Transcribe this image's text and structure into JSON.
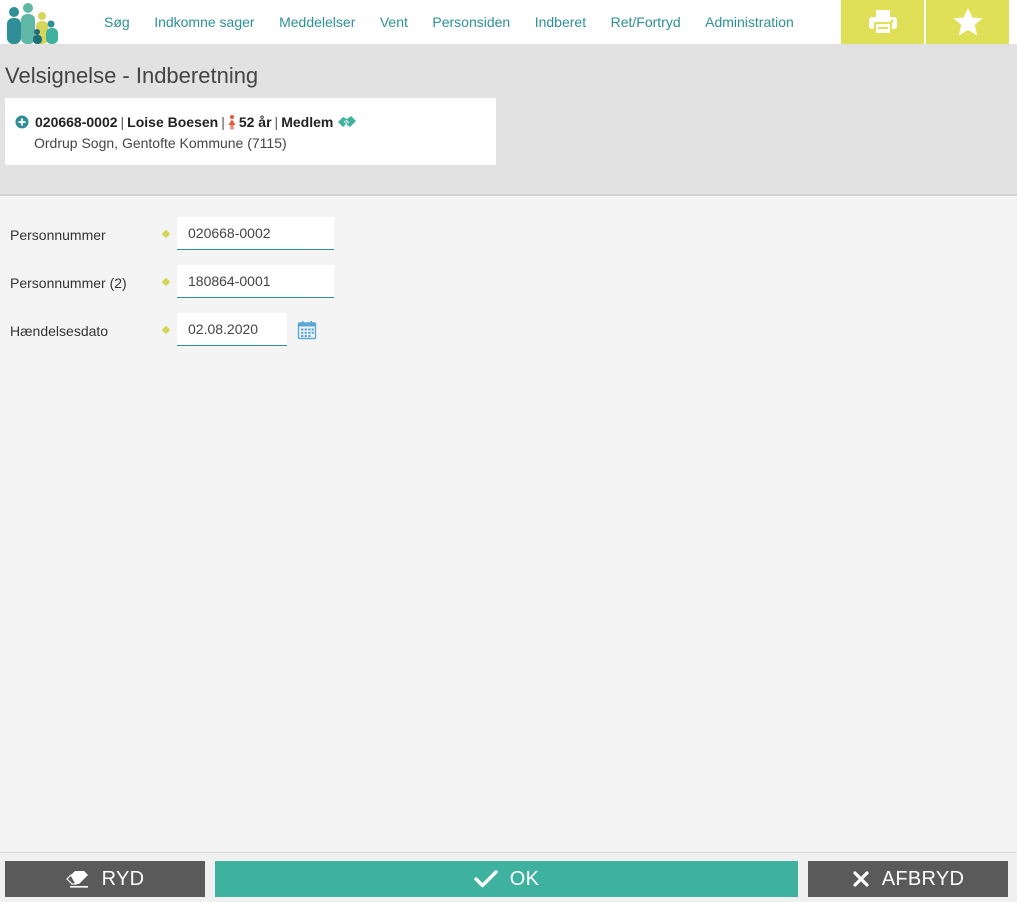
{
  "nav": {
    "items": [
      {
        "label": "Søg"
      },
      {
        "label": "Indkomne sager"
      },
      {
        "label": "Meddelelser"
      },
      {
        "label": "Vent"
      },
      {
        "label": "Personsiden"
      },
      {
        "label": "Indberet"
      },
      {
        "label": "Ret/Fortryd"
      },
      {
        "label": "Administration"
      }
    ],
    "tools": {
      "print_icon": "print-icon",
      "favorite_icon": "star-icon"
    }
  },
  "header": {
    "title": "Velsignelse - Indberetning",
    "person": {
      "cpr": "020668-0002",
      "name": "Loise Boesen",
      "age": "52 år",
      "status": "Medlem",
      "location": "Ordrup Sogn, Gentofte Kommune (7115)"
    }
  },
  "form": {
    "fields": [
      {
        "label": "Personnummer",
        "value": "020668-0002"
      },
      {
        "label": "Personnummer (2)",
        "value": "180864-0001"
      },
      {
        "label": "Hændelsesdato",
        "value": "02.08.2020"
      }
    ]
  },
  "footer": {
    "clear_label": "RYD",
    "ok_label": "OK",
    "cancel_label": "AFBRYD"
  },
  "colors": {
    "accent": "#2e8f98",
    "ok": "#3fb29f",
    "tool": "#e0e058",
    "dark_button": "#5a5a5a"
  }
}
